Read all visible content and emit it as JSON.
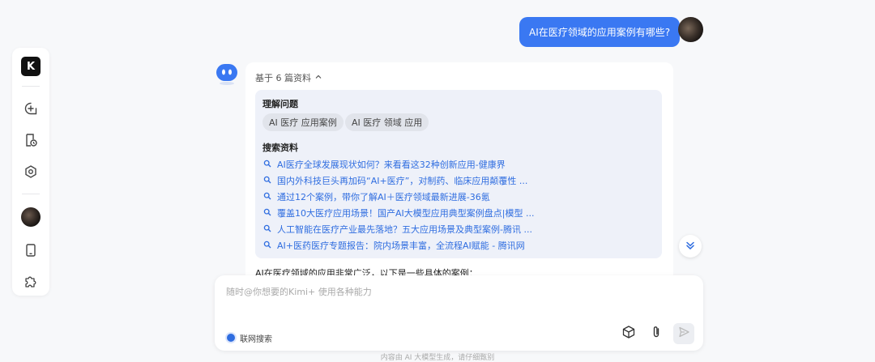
{
  "sidebar": {
    "logo_text": "K",
    "items": [
      {
        "icon": "new-chat-icon"
      },
      {
        "icon": "history-icon"
      },
      {
        "icon": "kimi-plus-icon"
      },
      {
        "icon": "avatar"
      },
      {
        "icon": "tablet-icon"
      },
      {
        "icon": "plugin-icon"
      }
    ]
  },
  "user_message": "AI在医疗领域的应用案例有哪些?",
  "answer": {
    "refs_toggle": "基于 6 篇资料",
    "understand_heading": "理解问题",
    "tags": [
      "AI 医疗 应用案例",
      "AI 医疗 领域 应用"
    ],
    "search_heading": "搜索资料",
    "links": [
      "AI医疗全球发展现状如何？来看看这32种创新应用-健康界",
      "国内外科技巨头再加码“AI+医疗”，对制药、临床应用颠覆性 ...",
      "通过12个案例，带你了解AI＋医疗领域最新进展-36氪",
      "覆盖10大医疗应用场景！国产AI大模型应用典型案例盘点|模型 ...",
      "人工智能在医疗产业最先落地？五大应用场景及典型案例-腾讯 ...",
      "AI+医药医疗专题报告：院内场景丰富，全流程AI赋能 - 腾讯网"
    ],
    "intro": "AI在医疗领域的应用非常广泛，以下是一些具体的案例："
  },
  "input": {
    "placeholder": "随时@你想要的Kimi+ 使用各种能力",
    "web_search_label": "联网搜索"
  },
  "footer": "内容由 AI 大模型生成，请仔细甄别",
  "colors": {
    "accent": "#3a78f2",
    "link": "#2f6de0",
    "panel_bg": "#eef1f9"
  }
}
